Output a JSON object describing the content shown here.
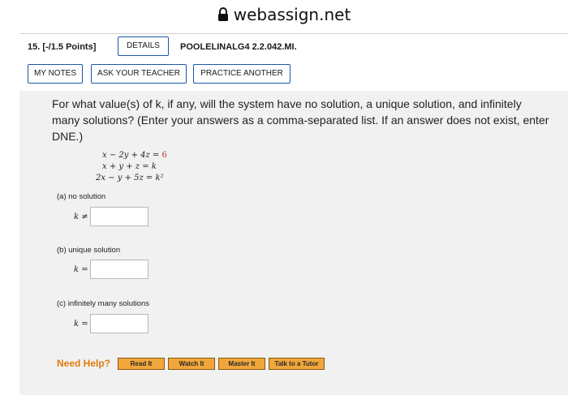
{
  "browser": {
    "url": "webassign.net"
  },
  "question": {
    "number_points": "15. [-/1.5 Points]",
    "details_label": "DETAILS",
    "code": "POOLELINALG4 2.2.042.MI.",
    "my_notes_label": "MY NOTES",
    "ask_teacher_label": "ASK YOUR TEACHER",
    "practice_label": "PRACTICE ANOTHER",
    "prompt": "For what value(s) of k, if any, will the system have no solution, a unique solution, and infinitely many solutions? (Enter your answers as a comma-separated list. If an answer does not exist, enter DNE.)",
    "equations": [
      {
        "lhs": "x − 2y + 4z =",
        "rhs": "6"
      },
      {
        "lhs": "x +  y +  z =",
        "rhs": "k"
      },
      {
        "lhs": "2x −  y + 5z =",
        "rhs": "k²"
      }
    ],
    "parts": [
      {
        "label": "(a)  no solution",
        "k_label": "k ≠",
        "value": ""
      },
      {
        "label": "(b)  unique solution",
        "k_label": "k =",
        "value": ""
      },
      {
        "label": "(c)  infinitely many solutions",
        "k_label": "k =",
        "value": ""
      }
    ]
  },
  "help": {
    "label": "Need Help?",
    "read_it": "Read It",
    "watch_it": "Watch It",
    "master_it": "Master It",
    "talk_tutor": "Talk to a Tutor"
  },
  "colors": {
    "button_border": "#1b57a8",
    "help_orange": "#e07c0c",
    "help_button": "#f0a63a",
    "panel_bg": "#f1f1f1"
  }
}
